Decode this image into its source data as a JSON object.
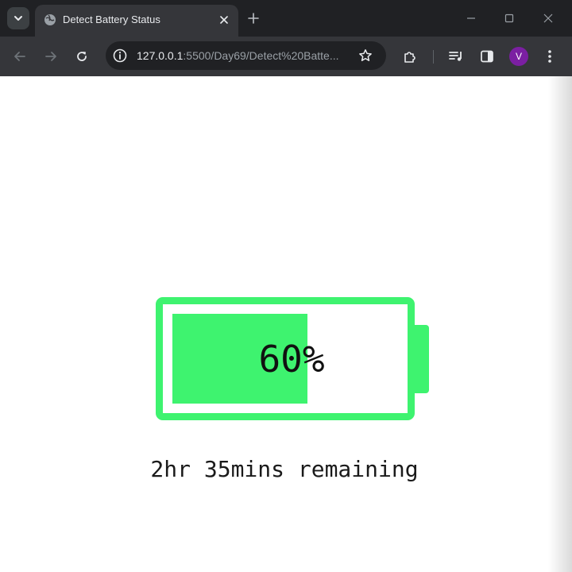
{
  "tab": {
    "title": "Detect Battery Status"
  },
  "address_bar": {
    "url_host": "127.0.0.1",
    "url_rest": ":5500/Day69/Detect%20Batte..."
  },
  "profile": {
    "initial": "V"
  },
  "battery": {
    "level_fraction": 0.6,
    "percent_label": "60%",
    "time_remaining": "2hr 35mins remaining"
  },
  "colors": {
    "battery_green": "#3ef36f",
    "profile_purple": "#7b1fa2"
  },
  "icons": {
    "tab_search": "chevron-down-icon",
    "favicon": "globe-icon",
    "tab_close": "close-icon",
    "new_tab": "plus-icon",
    "back": "arrow-left-icon",
    "forward": "arrow-right-icon",
    "reload": "reload-icon",
    "site_info": "info-icon",
    "bookmark": "star-icon",
    "extensions": "puzzle-icon",
    "media": "media-queue-icon",
    "side_panel": "side-panel-icon",
    "menu": "kebab-menu-icon"
  }
}
